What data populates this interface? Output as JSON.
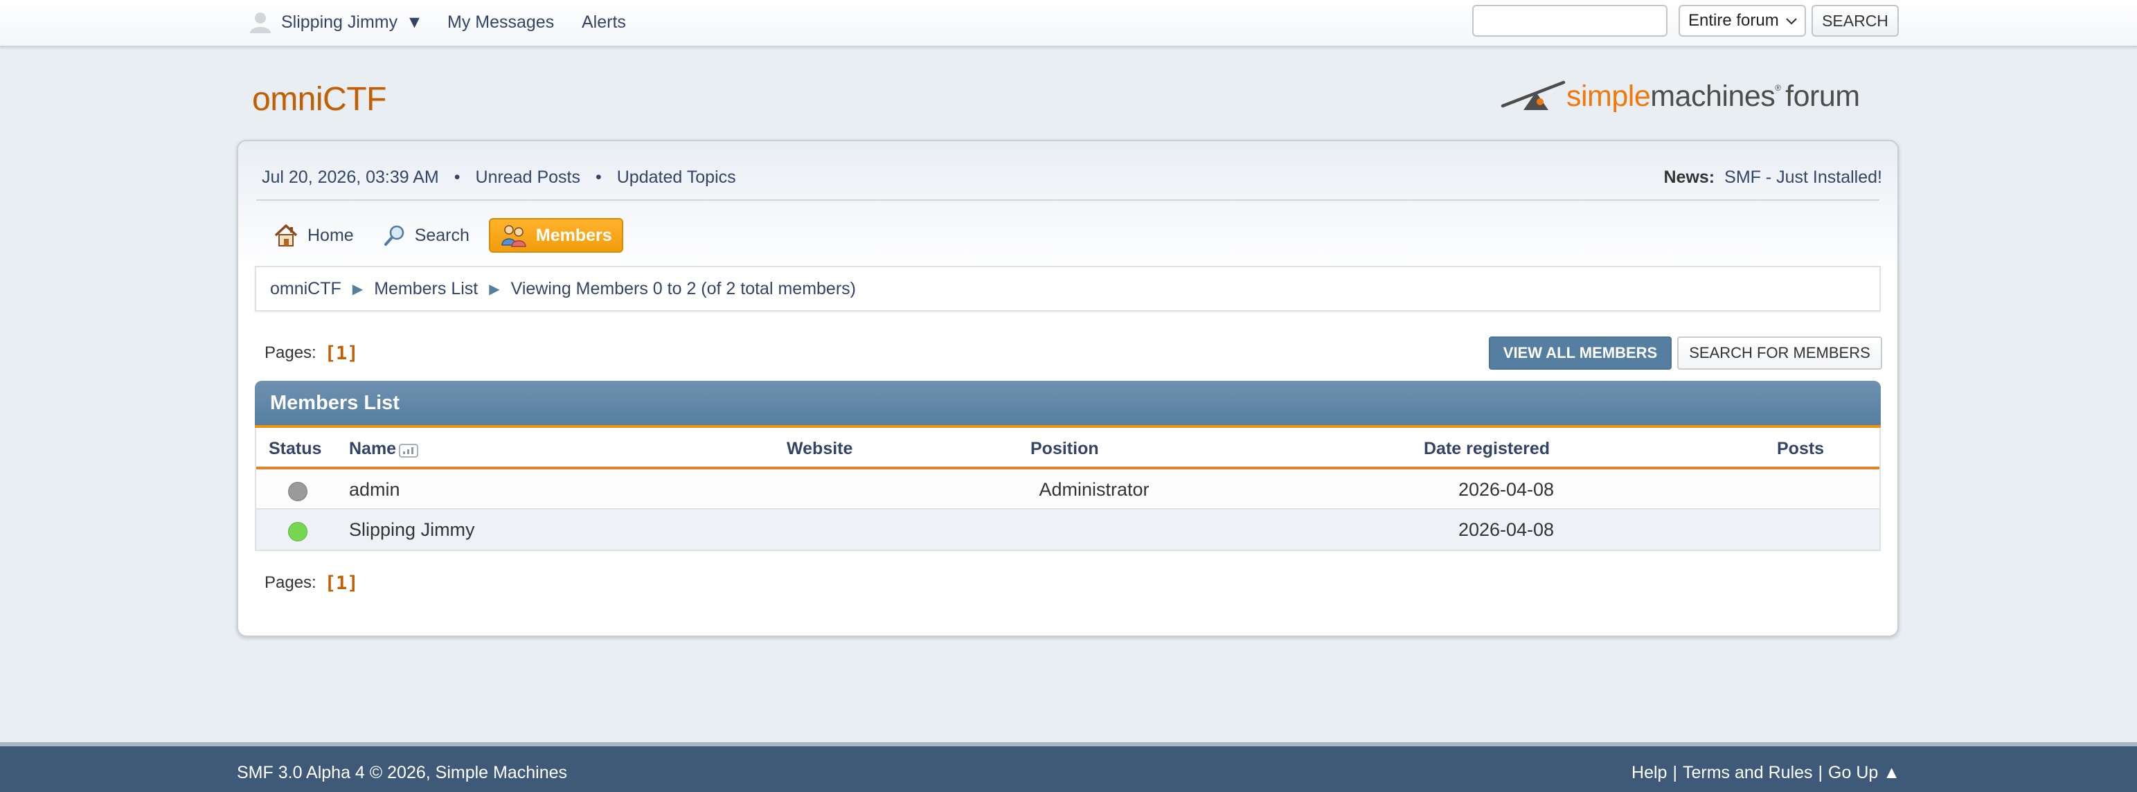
{
  "topbar": {
    "user_name": "Slipping Jimmy",
    "user_caret": "▼",
    "my_messages": "My Messages",
    "alerts": "Alerts",
    "search_value": "",
    "search_scope": "Entire forum",
    "search_button": "SEARCH"
  },
  "header": {
    "forum_title": "omniCTF",
    "logo_simple": "simple",
    "logo_machines": "machines",
    "logo_forum": "forum",
    "logo_colors": {
      "simple": "#f0790e",
      "machines": "#4d4d4d"
    }
  },
  "infobar": {
    "datetime": "Jul 20, 2026, 03:39 AM",
    "unread_posts": "Unread Posts",
    "updated_topics": "Updated Topics",
    "news_label": "News:",
    "news_text": "SMF - Just Installed!"
  },
  "menu": {
    "items": [
      {
        "label": "Home",
        "icon": "home-icon"
      },
      {
        "label": "Search",
        "icon": "search-icon"
      },
      {
        "label": "Members",
        "icon": "members-icon",
        "active": true
      }
    ],
    "accent": "#f29c0c"
  },
  "breadcrumb": {
    "items": [
      "omniCTF",
      "Members List",
      "Viewing Members 0 to 2 (of 2 total members)"
    ]
  },
  "pagination": {
    "label": "Pages:",
    "current": "[1]"
  },
  "buttons": {
    "view_all": "VIEW ALL MEMBERS",
    "search_members": "SEARCH FOR MEMBERS"
  },
  "members": {
    "title": "Members List",
    "columns": [
      "Status",
      "Name",
      "Website",
      "Position",
      "Date registered",
      "Posts"
    ],
    "rows": [
      {
        "status": "offline",
        "name": "admin",
        "website": "",
        "position": "Administrator",
        "date_registered": "2026-04-08",
        "posts": ""
      },
      {
        "status": "online",
        "name": "Slipping Jimmy",
        "website": "",
        "position": "",
        "date_registered": "2026-04-08",
        "posts": ""
      }
    ],
    "status_colors": {
      "offline": "#9a9a9a",
      "online": "#77d653"
    }
  },
  "footer": {
    "copyright": "SMF 3.0 Alpha 4 © 2026, Simple Machines",
    "help": "Help",
    "terms": "Terms and Rules",
    "go_up": "Go Up ▲",
    "sep": "|"
  }
}
